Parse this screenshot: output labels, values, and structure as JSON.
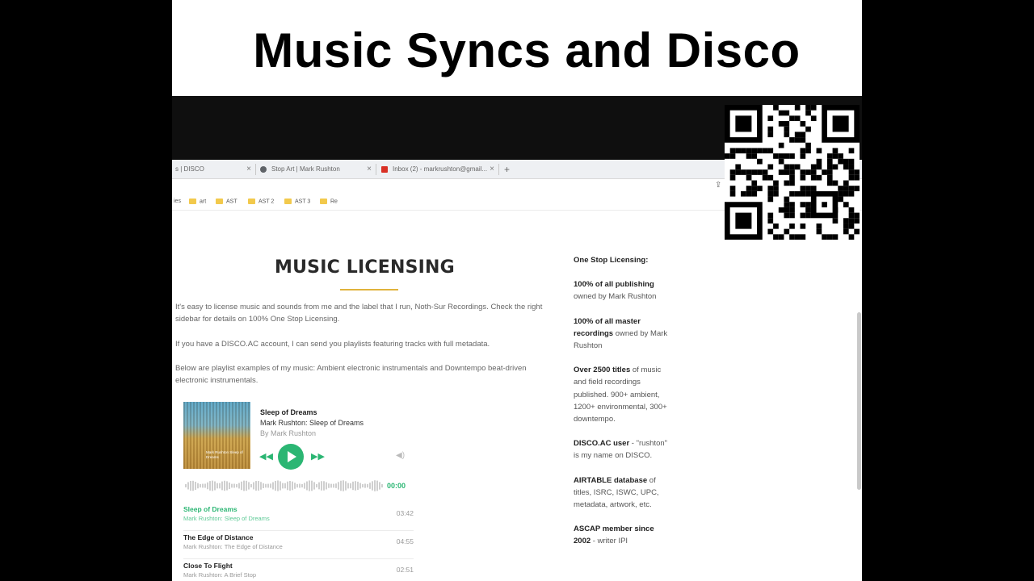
{
  "slide": {
    "title": "Music Syncs and Disco"
  },
  "browser": {
    "tabs": [
      {
        "label": "s | DISCO",
        "fav_color": "#ffffff"
      },
      {
        "label": "Stop Art | Mark Rushton",
        "fav_color": "#5f6368"
      },
      {
        "label": "Inbox (2) - markrushton@gmail...",
        "fav_color": "#d93025"
      }
    ],
    "new_tab": "+",
    "bookmarks": [
      "ies",
      "art",
      "AST",
      "AST 2",
      "AST 3",
      "Re"
    ]
  },
  "page": {
    "heading": "MUSIC LICENSING",
    "paragraphs": [
      "It's easy to license music and sounds from me and the label that I run, Noth-Sur Recordings.  Check the right sidebar for details on 100% One Stop Licensing.",
      "If you have a DISCO.AC account, I can send you playlists featuring tracks with full metadata.",
      "Below are playlist examples of my music:  Ambient electronic instrumentals and Downtempo beat-driven electronic instrumentals."
    ]
  },
  "player": {
    "album_art_text": "Mark Rushton Sleep of Dreams",
    "title": "Sleep of Dreams",
    "album": "Mark Rushton: Sleep of Dreams",
    "artist": "By Mark Rushton",
    "time": "00:00",
    "tracks": [
      {
        "title": "Sleep of Dreams",
        "subtitle": "Mark Rushton: Sleep of Dreams",
        "duration": "03:42"
      },
      {
        "title": "The Edge of Distance",
        "subtitle": "Mark Rushton: The Edge of Distance",
        "duration": "04:55"
      },
      {
        "title": "Close To Flight",
        "subtitle": "Mark Rushton: A Brief Stop",
        "duration": "02:51"
      }
    ],
    "accent": "#2bb673"
  },
  "sidebar": {
    "blocks": [
      {
        "bold": "One Stop Licensing:",
        "text": ""
      },
      {
        "bold": "100% of all publishing",
        "text": " owned by Mark Rushton"
      },
      {
        "bold": "100% of all master recordings",
        "text": " owned by Mark Rushton"
      },
      {
        "bold": "Over 2500 titles",
        "text": " of music and field recordings published. 900+ ambient, 1200+ environmental, 300+ downtempo."
      },
      {
        "bold": "DISCO.AC user",
        "text": " - \"rushton\" is my name on DISCO."
      },
      {
        "bold": "AIRTABLE database",
        "text": " of titles, ISRC, ISWC, UPC, metadata, artwork, etc."
      },
      {
        "bold": "ASCAP member since 2002",
        "text": " - writer IPI"
      }
    ]
  },
  "overlay": {
    "qr_code": "qr-code"
  }
}
